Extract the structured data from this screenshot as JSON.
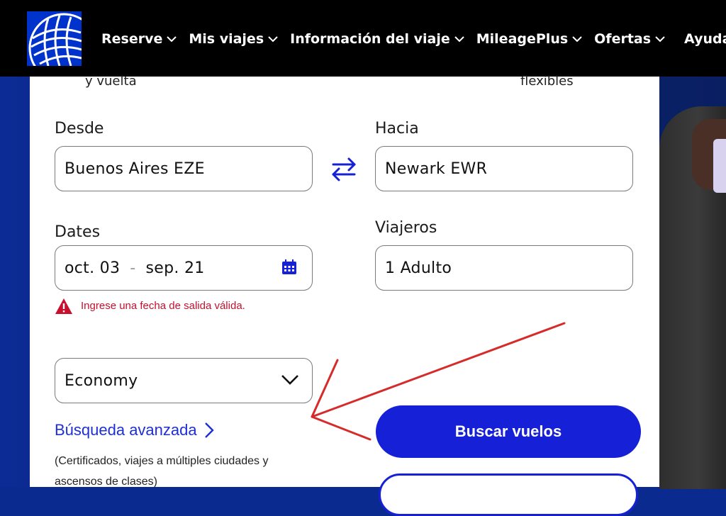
{
  "header": {
    "nav": [
      {
        "label": "Reserve",
        "has_dropdown": true
      },
      {
        "label": "Mis viajes",
        "has_dropdown": true
      },
      {
        "label": "Información del viaje",
        "has_dropdown": true
      },
      {
        "label": "MileagePlus",
        "has_dropdown": true
      },
      {
        "label": "Ofertas",
        "has_dropdown": true
      },
      {
        "label": "Ayuda",
        "has_dropdown": false
      }
    ]
  },
  "form": {
    "trip_type_partial": "y vuelta",
    "flexible_partial": "flexibles",
    "from_label": "Desde",
    "from_value": "Buenos Aires EZE",
    "to_label": "Hacia",
    "to_value": "Newark EWR",
    "dates_label": "Dates",
    "depart_date": "oct. 03",
    "date_separator": "-",
    "return_date": "sep. 21",
    "date_error": "Ingrese una fecha de salida válida.",
    "travelers_label": "Viajeros",
    "travelers_value": "1 Adulto",
    "cabin_value": "Economy",
    "advanced_search_label": "Búsqueda avanzada",
    "advanced_search_note": "(Certificados, viajes a múltiples ciudades y ascensos de clases)",
    "search_button": "Buscar vuelos"
  },
  "colors": {
    "brand_blue": "#1620d6",
    "error_red": "#c8102e",
    "annotation_red": "#d62b2b"
  }
}
